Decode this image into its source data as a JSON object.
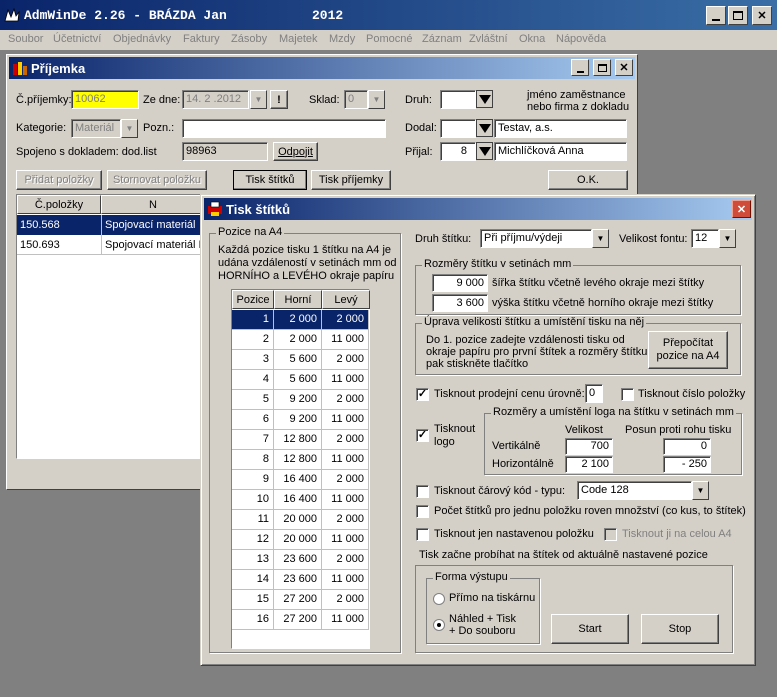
{
  "app": {
    "title": "AdmWinDe 2.26 - BRÁZDA Jan",
    "year": "2012"
  },
  "menu": [
    "Soubor",
    "Účetnictví",
    "Objednávky",
    "Faktury",
    "Zásoby",
    "Majetek",
    "Mzdy",
    "Pomocné",
    "Záznam",
    "Zvláštní",
    "Okna",
    "Nápověda"
  ],
  "prijemka": {
    "title": "Příjemka",
    "cislo_label": "Č.příjemky:",
    "cislo_value": "10062",
    "zedne_label": "Ze dne:",
    "zedne_value": "14. 2 .2012",
    "excl": "!",
    "sklad_label": "Sklad:",
    "sklad_value": "0",
    "druh_label": "Druh:",
    "jmeno_note": "jméno zaměstnance nebo firma z dokladu",
    "kategorie_label": "Kategorie:",
    "kategorie_value": "Materiál",
    "pozn_label": "Pozn.:",
    "dodal_label": "Dodal:",
    "dodal_name": "Testav, a.s.",
    "spojeno_label": "Spojeno s dokladem: dod.list",
    "spojeno_value": "98963",
    "odpojit": "Odpojit",
    "prijal_label": "Přijal:",
    "prijal_value": "8",
    "prijal_name": "Michlíčková Anna",
    "pridat": "Přidat položky",
    "stornovat": "Stornovat položku",
    "tisk_stitku": "Tisk štítků",
    "tisk_prijemky": "Tisk příjemky",
    "ok": "O.K.",
    "col_cpolozky": "Č.položky",
    "col_n": "N",
    "rows": [
      {
        "cislo": "150.568",
        "nazev": "Spojovací materiál"
      },
      {
        "cislo": "150.693",
        "nazev": "Spojovací materiál II"
      }
    ]
  },
  "dialog": {
    "title": "Tisk štítků",
    "pozice_group": "Pozice na A4",
    "pozice_note": "Každá pozice tisku 1 štítku na A4 je udána vzdáleností v setinách mm od HORNÍHO a LEVÉHO okraje papíru",
    "col_pozice": "Pozice",
    "col_horni": "Horní",
    "col_levy": "Levý",
    "positions": [
      {
        "p": "1",
        "h": "2 000",
        "l": "2 000"
      },
      {
        "p": "2",
        "h": "2 000",
        "l": "11 000"
      },
      {
        "p": "3",
        "h": "5 600",
        "l": "2 000"
      },
      {
        "p": "4",
        "h": "5 600",
        "l": "11 000"
      },
      {
        "p": "5",
        "h": "9 200",
        "l": "2 000"
      },
      {
        "p": "6",
        "h": "9 200",
        "l": "11 000"
      },
      {
        "p": "7",
        "h": "12 800",
        "l": "2 000"
      },
      {
        "p": "8",
        "h": "12 800",
        "l": "11 000"
      },
      {
        "p": "9",
        "h": "16 400",
        "l": "2 000"
      },
      {
        "p": "10",
        "h": "16 400",
        "l": "11 000"
      },
      {
        "p": "11",
        "h": "20 000",
        "l": "2 000"
      },
      {
        "p": "12",
        "h": "20 000",
        "l": "11 000"
      },
      {
        "p": "13",
        "h": "23 600",
        "l": "2 000"
      },
      {
        "p": "14",
        "h": "23 600",
        "l": "11 000"
      },
      {
        "p": "15",
        "h": "27 200",
        "l": "2 000"
      },
      {
        "p": "16",
        "h": "27 200",
        "l": "11 000"
      }
    ],
    "druh_label": "Druh štítku:",
    "druh_value": "Při příjmu/výdeji",
    "velikost_label": "Velikost fontu:",
    "velikost_value": "12",
    "rozmery_group": "Rozměry štítku v setinách mm",
    "sirka_value": "9 000",
    "sirka_label": "šířka štítku včetně levého okraje mezi štítky",
    "vyska_value": "3 600",
    "vyska_label": "výška štítku včetně horního okraje mezi štítky",
    "uprava_group": "Úprava velikosti štítku a umístění tisku na něj",
    "uprava_note": "Do 1. pozice zadejte vzdálenosti tisku od okraje papíru pro první štítek a rozměry štítku, pak stiskněte tlačítko",
    "prepocitat": "Přepočítat pozice na A4",
    "tisk_cenu_label": "Tisknout prodejní cenu úrovně:",
    "tisk_cenu_value": "0",
    "tisk_cislo_label": "Tisknout číslo položky",
    "tisk_logo_label": "Tisknout logo",
    "logo_group": "Rozměry a umístění loga na štítku v setinách mm",
    "col_velikost": "Velikost",
    "col_posun": "Posun proti rohu tisku",
    "vertikalne": "Vertikálně",
    "horizontalne": "Horizontálně",
    "vert_velikost": "700",
    "vert_posun": "0",
    "hor_velikost": "2 100",
    "hor_posun": "- 250",
    "carovy_label": "Tisknout čárový kód - typu:",
    "carovy_value": "Code 128",
    "pocet_label": "Počet štítků pro jednu položku roven množství (co kus, to štítek)",
    "jen_label": "Tisknout jen nastavenou položku",
    "celou_label": "Tisknout ji na celou A4",
    "zacne_note": "Tisk začne probíhat na štítek od aktuálně nastavené pozice",
    "forma_group": "Forma výstupu",
    "primo": "Přímo na tiskárnu",
    "nahled": "Náhled + Tisk\n+ Do souboru",
    "start": "Start",
    "stop": "Stop"
  }
}
